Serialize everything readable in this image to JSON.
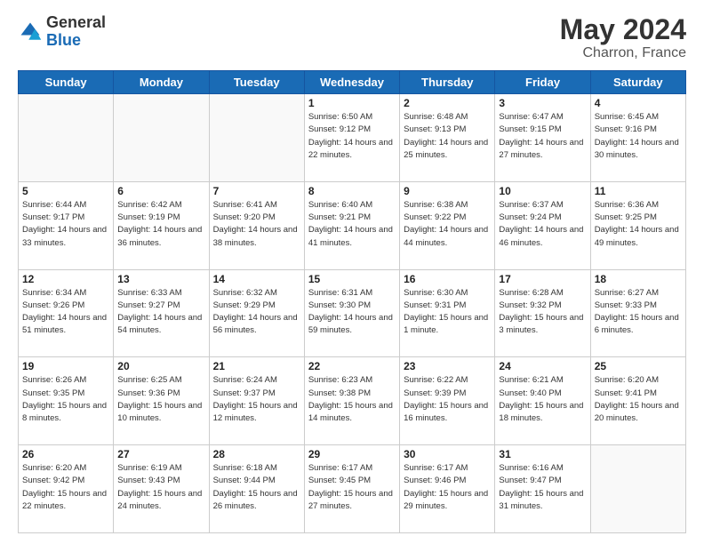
{
  "header": {
    "logo_general": "General",
    "logo_blue": "Blue",
    "title": "May 2024",
    "location": "Charron, France"
  },
  "days_of_week": [
    "Sunday",
    "Monday",
    "Tuesday",
    "Wednesday",
    "Thursday",
    "Friday",
    "Saturday"
  ],
  "weeks": [
    [
      {
        "day": "",
        "sunrise": "",
        "sunset": "",
        "daylight": ""
      },
      {
        "day": "",
        "sunrise": "",
        "sunset": "",
        "daylight": ""
      },
      {
        "day": "",
        "sunrise": "",
        "sunset": "",
        "daylight": ""
      },
      {
        "day": "1",
        "sunrise": "Sunrise: 6:50 AM",
        "sunset": "Sunset: 9:12 PM",
        "daylight": "Daylight: 14 hours and 22 minutes."
      },
      {
        "day": "2",
        "sunrise": "Sunrise: 6:48 AM",
        "sunset": "Sunset: 9:13 PM",
        "daylight": "Daylight: 14 hours and 25 minutes."
      },
      {
        "day": "3",
        "sunrise": "Sunrise: 6:47 AM",
        "sunset": "Sunset: 9:15 PM",
        "daylight": "Daylight: 14 hours and 27 minutes."
      },
      {
        "day": "4",
        "sunrise": "Sunrise: 6:45 AM",
        "sunset": "Sunset: 9:16 PM",
        "daylight": "Daylight: 14 hours and 30 minutes."
      }
    ],
    [
      {
        "day": "5",
        "sunrise": "Sunrise: 6:44 AM",
        "sunset": "Sunset: 9:17 PM",
        "daylight": "Daylight: 14 hours and 33 minutes."
      },
      {
        "day": "6",
        "sunrise": "Sunrise: 6:42 AM",
        "sunset": "Sunset: 9:19 PM",
        "daylight": "Daylight: 14 hours and 36 minutes."
      },
      {
        "day": "7",
        "sunrise": "Sunrise: 6:41 AM",
        "sunset": "Sunset: 9:20 PM",
        "daylight": "Daylight: 14 hours and 38 minutes."
      },
      {
        "day": "8",
        "sunrise": "Sunrise: 6:40 AM",
        "sunset": "Sunset: 9:21 PM",
        "daylight": "Daylight: 14 hours and 41 minutes."
      },
      {
        "day": "9",
        "sunrise": "Sunrise: 6:38 AM",
        "sunset": "Sunset: 9:22 PM",
        "daylight": "Daylight: 14 hours and 44 minutes."
      },
      {
        "day": "10",
        "sunrise": "Sunrise: 6:37 AM",
        "sunset": "Sunset: 9:24 PM",
        "daylight": "Daylight: 14 hours and 46 minutes."
      },
      {
        "day": "11",
        "sunrise": "Sunrise: 6:36 AM",
        "sunset": "Sunset: 9:25 PM",
        "daylight": "Daylight: 14 hours and 49 minutes."
      }
    ],
    [
      {
        "day": "12",
        "sunrise": "Sunrise: 6:34 AM",
        "sunset": "Sunset: 9:26 PM",
        "daylight": "Daylight: 14 hours and 51 minutes."
      },
      {
        "day": "13",
        "sunrise": "Sunrise: 6:33 AM",
        "sunset": "Sunset: 9:27 PM",
        "daylight": "Daylight: 14 hours and 54 minutes."
      },
      {
        "day": "14",
        "sunrise": "Sunrise: 6:32 AM",
        "sunset": "Sunset: 9:29 PM",
        "daylight": "Daylight: 14 hours and 56 minutes."
      },
      {
        "day": "15",
        "sunrise": "Sunrise: 6:31 AM",
        "sunset": "Sunset: 9:30 PM",
        "daylight": "Daylight: 14 hours and 59 minutes."
      },
      {
        "day": "16",
        "sunrise": "Sunrise: 6:30 AM",
        "sunset": "Sunset: 9:31 PM",
        "daylight": "Daylight: 15 hours and 1 minute."
      },
      {
        "day": "17",
        "sunrise": "Sunrise: 6:28 AM",
        "sunset": "Sunset: 9:32 PM",
        "daylight": "Daylight: 15 hours and 3 minutes."
      },
      {
        "day": "18",
        "sunrise": "Sunrise: 6:27 AM",
        "sunset": "Sunset: 9:33 PM",
        "daylight": "Daylight: 15 hours and 6 minutes."
      }
    ],
    [
      {
        "day": "19",
        "sunrise": "Sunrise: 6:26 AM",
        "sunset": "Sunset: 9:35 PM",
        "daylight": "Daylight: 15 hours and 8 minutes."
      },
      {
        "day": "20",
        "sunrise": "Sunrise: 6:25 AM",
        "sunset": "Sunset: 9:36 PM",
        "daylight": "Daylight: 15 hours and 10 minutes."
      },
      {
        "day": "21",
        "sunrise": "Sunrise: 6:24 AM",
        "sunset": "Sunset: 9:37 PM",
        "daylight": "Daylight: 15 hours and 12 minutes."
      },
      {
        "day": "22",
        "sunrise": "Sunrise: 6:23 AM",
        "sunset": "Sunset: 9:38 PM",
        "daylight": "Daylight: 15 hours and 14 minutes."
      },
      {
        "day": "23",
        "sunrise": "Sunrise: 6:22 AM",
        "sunset": "Sunset: 9:39 PM",
        "daylight": "Daylight: 15 hours and 16 minutes."
      },
      {
        "day": "24",
        "sunrise": "Sunrise: 6:21 AM",
        "sunset": "Sunset: 9:40 PM",
        "daylight": "Daylight: 15 hours and 18 minutes."
      },
      {
        "day": "25",
        "sunrise": "Sunrise: 6:20 AM",
        "sunset": "Sunset: 9:41 PM",
        "daylight": "Daylight: 15 hours and 20 minutes."
      }
    ],
    [
      {
        "day": "26",
        "sunrise": "Sunrise: 6:20 AM",
        "sunset": "Sunset: 9:42 PM",
        "daylight": "Daylight: 15 hours and 22 minutes."
      },
      {
        "day": "27",
        "sunrise": "Sunrise: 6:19 AM",
        "sunset": "Sunset: 9:43 PM",
        "daylight": "Daylight: 15 hours and 24 minutes."
      },
      {
        "day": "28",
        "sunrise": "Sunrise: 6:18 AM",
        "sunset": "Sunset: 9:44 PM",
        "daylight": "Daylight: 15 hours and 26 minutes."
      },
      {
        "day": "29",
        "sunrise": "Sunrise: 6:17 AM",
        "sunset": "Sunset: 9:45 PM",
        "daylight": "Daylight: 15 hours and 27 minutes."
      },
      {
        "day": "30",
        "sunrise": "Sunrise: 6:17 AM",
        "sunset": "Sunset: 9:46 PM",
        "daylight": "Daylight: 15 hours and 29 minutes."
      },
      {
        "day": "31",
        "sunrise": "Sunrise: 6:16 AM",
        "sunset": "Sunset: 9:47 PM",
        "daylight": "Daylight: 15 hours and 31 minutes."
      },
      {
        "day": "",
        "sunrise": "",
        "sunset": "",
        "daylight": ""
      }
    ]
  ]
}
